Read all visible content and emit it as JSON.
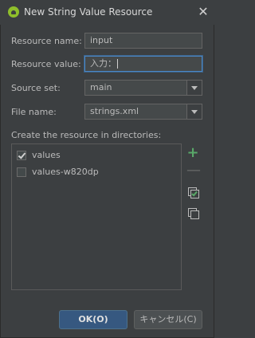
{
  "window": {
    "title": "New String Value Resource",
    "close_glyph": "✕"
  },
  "form": {
    "resource_name": {
      "label": "Resource name:",
      "value": "input"
    },
    "resource_value": {
      "label": "Resource value:",
      "value": "入力："
    },
    "source_set": {
      "label": "Source set:",
      "value": "main"
    },
    "file_name": {
      "label": "File name:",
      "value": "strings.xml"
    }
  },
  "directories": {
    "label": "Create the resource in directories:",
    "items": [
      {
        "label": "values",
        "checked": true
      },
      {
        "label": "values-w820dp",
        "checked": false
      }
    ],
    "tools": {
      "add_glyph": "+",
      "remove_glyph": "—"
    }
  },
  "buttons": {
    "ok": "OK(O)",
    "cancel": "キャンセル(C)"
  },
  "colors": {
    "background": "#3c3f41",
    "accent": "#365880",
    "focus": "#4a88c7",
    "add": "#59a869"
  }
}
